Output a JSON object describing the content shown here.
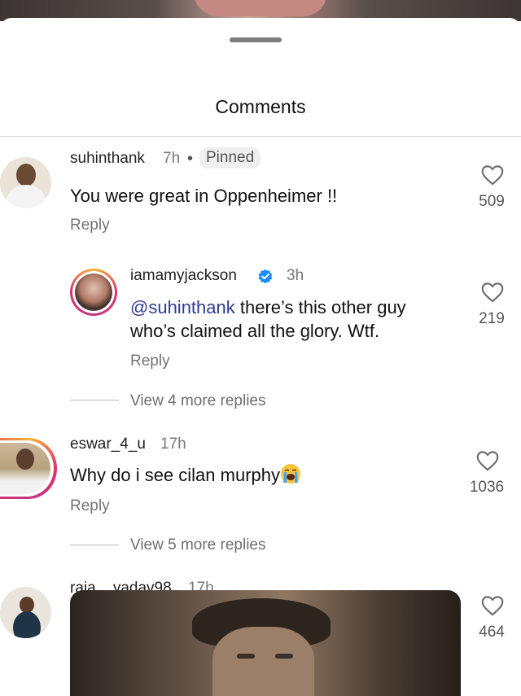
{
  "sheet": {
    "title": "Comments"
  },
  "comments": [
    {
      "username": "suhinthank",
      "time": "7h",
      "dot": "•",
      "pinned_label": "Pinned",
      "text": "You were great in Oppenheimer !!",
      "reply_label": "Reply",
      "likes": "509",
      "avatar_icon": "profile-photo",
      "replies": [
        {
          "username": "iamamyjackson",
          "verified": true,
          "time": "3h",
          "mention": "@suhinthank",
          "text": " there’s this other guy who’s claimed all the glory. Wtf.",
          "reply_label": "Reply",
          "likes": "219"
        }
      ],
      "view_more": "View 4 more replies"
    },
    {
      "username": "eswar_4_u",
      "time": "17h",
      "text": "Why do i see cilan murphy",
      "emoji": "loudly-crying-face",
      "reply_label": "Reply",
      "likes": "1036",
      "view_more": "View 5 more replies"
    },
    {
      "username": "raja__yadav98",
      "time": "17h",
      "likes": "464",
      "attachment": "image"
    }
  ],
  "colors": {
    "mention": "#2e3b8f",
    "verified": "#1d8cf8",
    "story_ring": "#e1306c"
  }
}
